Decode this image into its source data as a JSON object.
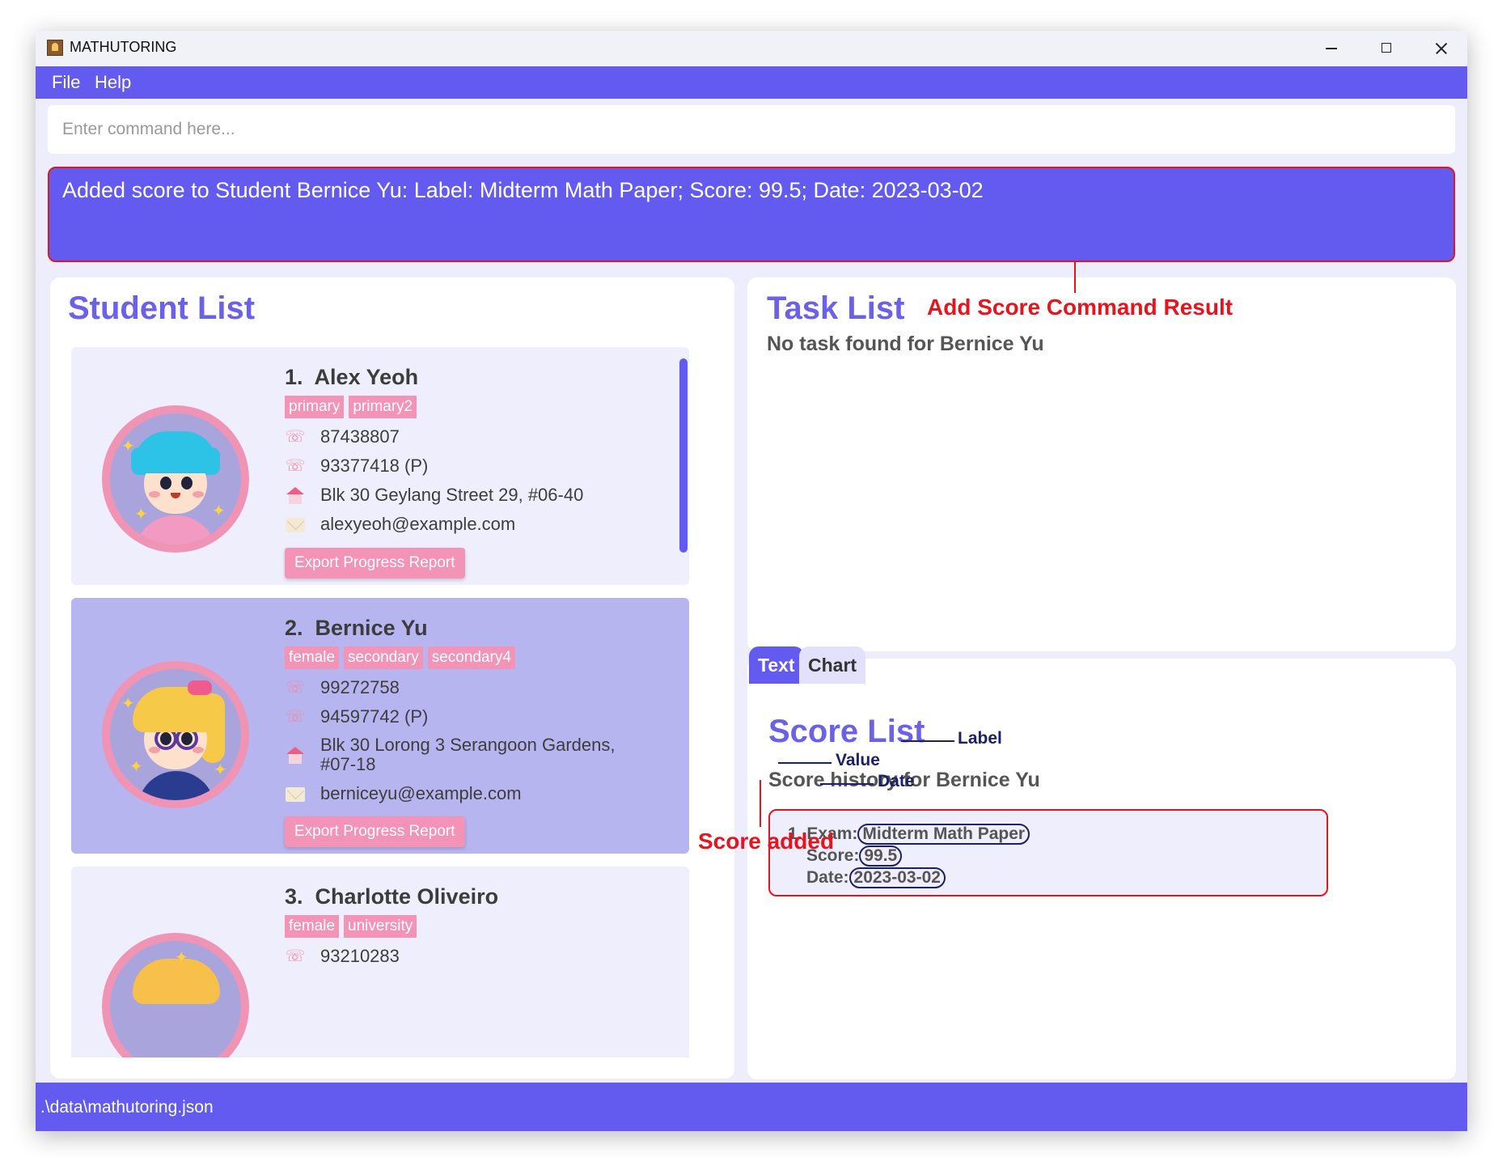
{
  "window": {
    "title": "MATHUTORING"
  },
  "menu": {
    "file": "File",
    "help": "Help"
  },
  "command": {
    "placeholder": "Enter command here..."
  },
  "result": {
    "text": "Added score to Student Bernice Yu: Label: Midterm Math Paper; Score: 99.5; Date: 2023-03-02"
  },
  "student_list": {
    "heading": "Student List",
    "students": [
      {
        "index": "1.",
        "name": "Alex Yeoh",
        "tags": [
          "primary",
          "primary2"
        ],
        "phone": "87438807",
        "parent_phone": "93377418 (P)",
        "address": "Blk 30 Geylang Street 29, #06-40",
        "email": "alexyeoh@example.com",
        "export_label": "Export Progress Report"
      },
      {
        "index": "2.",
        "name": "Bernice Yu",
        "tags": [
          "female",
          "secondary",
          "secondary4"
        ],
        "phone": "99272758",
        "parent_phone": "94597742 (P)",
        "address_line1": "Blk 30 Lorong 3 Serangoon Gardens,",
        "address_line2": "#07-18",
        "email": "berniceyu@example.com",
        "export_label": "Export Progress Report"
      },
      {
        "index": "3.",
        "name": "Charlotte Oliveiro",
        "tags": [
          "female",
          "university"
        ],
        "phone_partial": "93210283"
      }
    ]
  },
  "task_list": {
    "heading": "Task List",
    "empty_message": "No task found for Bernice Yu"
  },
  "score_tabs": {
    "text": "Text",
    "chart": "Chart"
  },
  "score_list": {
    "heading": "Score List",
    "subtitle": "Score history for Bernice Yu",
    "entry": {
      "exam_prefix": "1. Exam:",
      "exam_value": "Midterm Math Paper",
      "score_prefix": "Score:",
      "score_value": "99.5",
      "date_prefix": "Date:",
      "date_value": "2023-03-02"
    }
  },
  "annotations": {
    "command_result": "Add Score Command Result",
    "score_added": "Score added",
    "label": "Label",
    "value": "Value",
    "date": "Date"
  },
  "status_bar": {
    "path": ".\\data\\mathutoring.json"
  },
  "colors": {
    "primary": "#635bf0",
    "accent_pink": "#f393b5",
    "annotation_red": "#e8141d",
    "annotation_navy": "#1b1f63"
  }
}
